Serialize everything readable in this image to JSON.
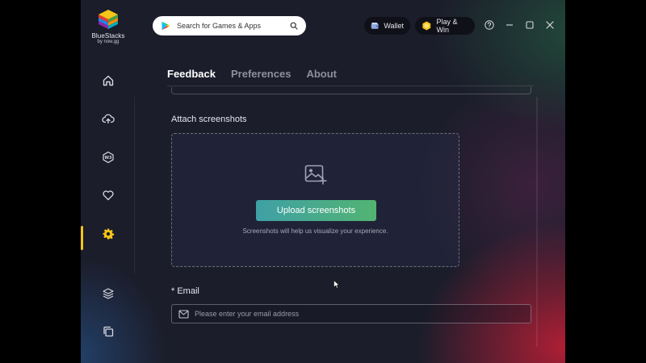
{
  "app": {
    "brand": "BlueStacks",
    "brand_sub": "by now.gg"
  },
  "search": {
    "placeholder": "Search for Games & Apps"
  },
  "topbar": {
    "wallet_label": "Wallet",
    "playwin_label": "Play & Win"
  },
  "sidebar": {
    "items": [
      {
        "icon": "home-icon"
      },
      {
        "icon": "cloud-upload-icon"
      },
      {
        "icon": "web3-icon"
      },
      {
        "icon": "heart-icon"
      },
      {
        "icon": "gear-icon"
      },
      {
        "icon": "layers-icon"
      },
      {
        "icon": "multi-instance-icon"
      }
    ]
  },
  "tabs": [
    {
      "label": "Feedback",
      "active": true
    },
    {
      "label": "Preferences",
      "active": false
    },
    {
      "label": "About",
      "active": false
    }
  ],
  "feedback": {
    "attach_label": "Attach screenshots",
    "upload_button": "Upload screenshots",
    "upload_hint": "Screenshots will help us visualize your experience.",
    "email_label": "* Email",
    "email_placeholder": "Please enter your email address"
  },
  "colors": {
    "accent_active": "#f5c518",
    "upload_gradient_start": "#3fa0a6",
    "upload_gradient_end": "#52b471",
    "background": "#1b1d2b"
  }
}
